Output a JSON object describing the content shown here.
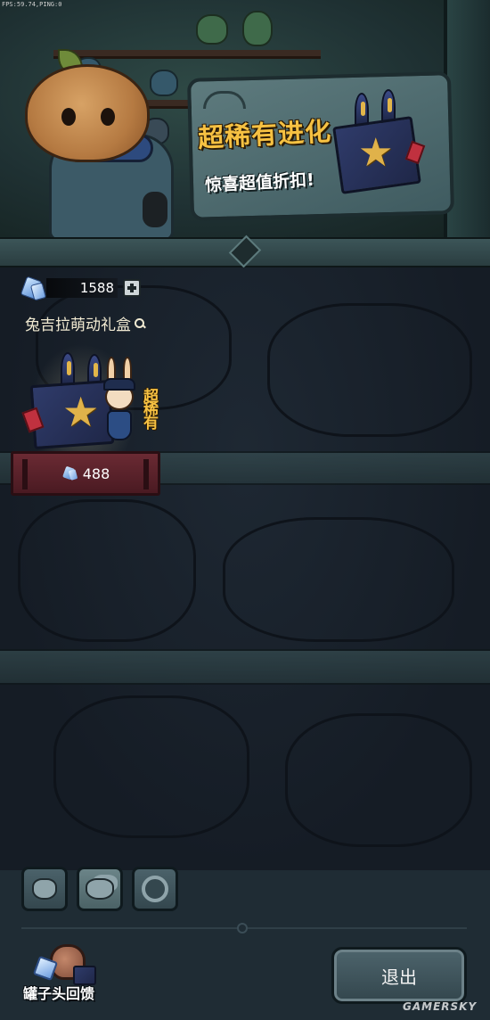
{
  "hud": {
    "fps_text": "FPS:59.74,PING:0"
  },
  "banner": {
    "promo_title": "超稀有进化",
    "promo_subtitle": "惊喜超值折扣!"
  },
  "currency": {
    "icon": "gem-icon",
    "amount": "1588",
    "add_icon": "plus-icon"
  },
  "shop": {
    "item_title": "兔吉拉萌动礼盒",
    "item_title_icon": "magnify-icon",
    "card": {
      "rarity_label": "超稀有",
      "price": "488",
      "price_icon": "gem-icon"
    }
  },
  "bottom_nav": {
    "tabs": [
      {
        "icon": "single-pot-icon"
      },
      {
        "icon": "multi-pot-icon",
        "active": true
      },
      {
        "icon": "wheel-icon"
      }
    ],
    "feedback_label": "罐子头回馈",
    "exit_label": "退出"
  },
  "watermark": "GAMERSKY",
  "colors": {
    "gold_text": "#f6c142",
    "price_plate": "#6a2a33",
    "background": "#151c25"
  }
}
